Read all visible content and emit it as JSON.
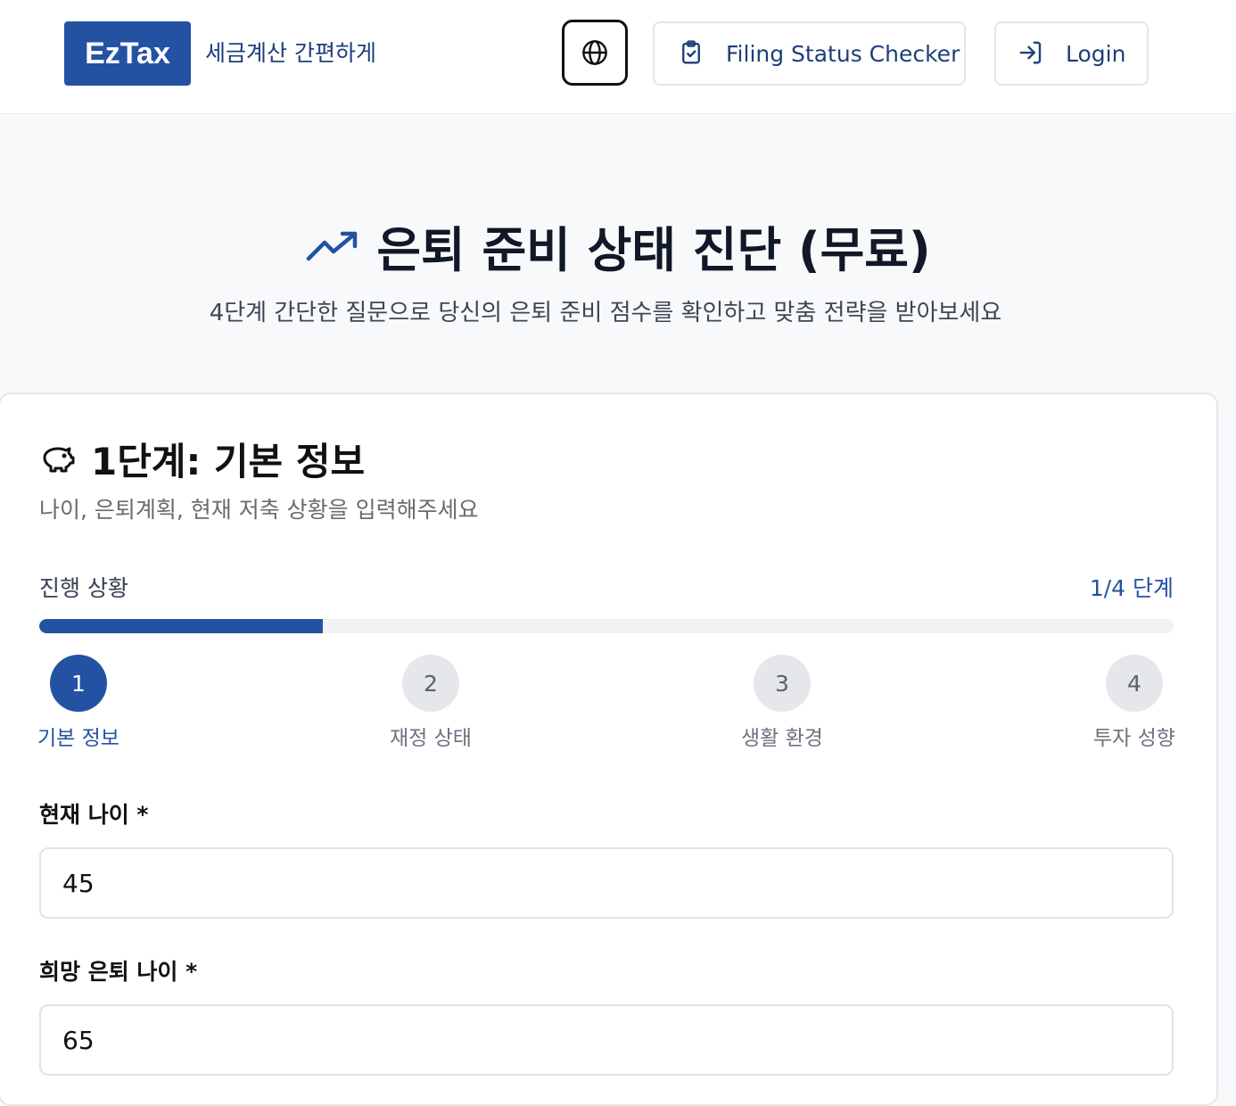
{
  "header": {
    "logo": "EzTax",
    "tagline": "세금계산 간편하게",
    "filing_button": "Filing Status Checker",
    "login_button": "Login"
  },
  "hero": {
    "title": "은퇴 준비 상태 진단 (무료)",
    "subtitle": "4단계 간단한 질문으로 당신의 은퇴 준비 점수를 확인하고 맞춤 전략을 받아보세요"
  },
  "card": {
    "step_title": "1단계: 기본 정보",
    "step_desc": "나이, 은퇴계획, 현재 저축 상황을 입력해주세요",
    "progress_label": "진행 상황",
    "progress_count": "1/4 단계",
    "progress_fraction": 0.25,
    "steps": [
      {
        "num": "1",
        "label": "기본 정보",
        "active": true
      },
      {
        "num": "2",
        "label": "재정 상태",
        "active": false
      },
      {
        "num": "3",
        "label": "생활 환경",
        "active": false
      },
      {
        "num": "4",
        "label": "투자 성향",
        "active": false
      }
    ],
    "fields": [
      {
        "label": "현재 나이 *",
        "value": "45"
      },
      {
        "label": "희망 은퇴 나이 *",
        "value": "65"
      }
    ]
  },
  "colors": {
    "brand": "#2452a3",
    "background": "#f8f9fb"
  }
}
